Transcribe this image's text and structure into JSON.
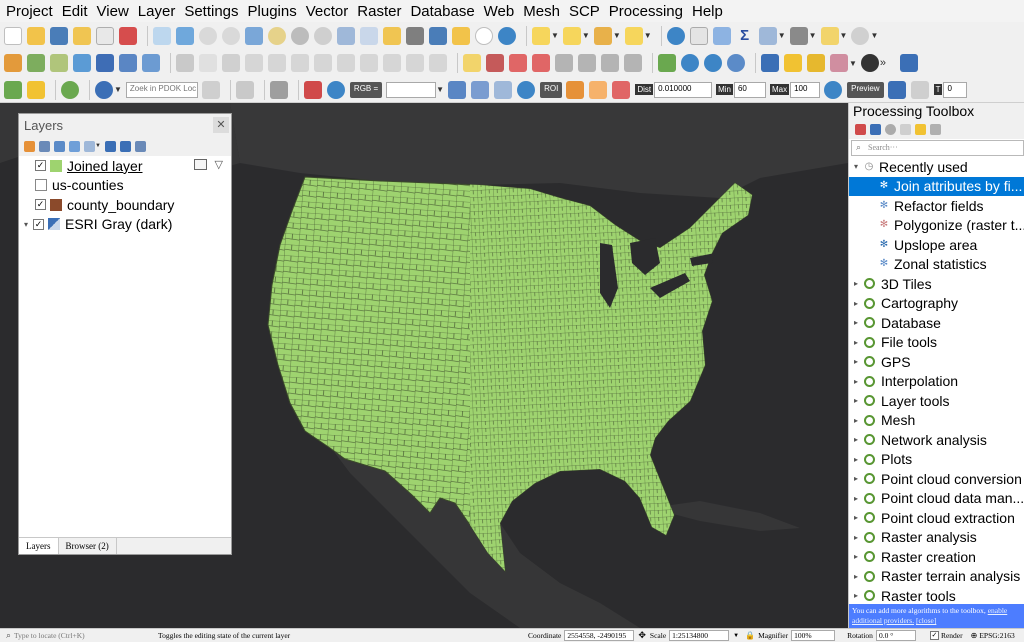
{
  "menubar": [
    "Project",
    "Edit",
    "View",
    "Layer",
    "Settings",
    "Plugins",
    "Vector",
    "Raster",
    "Database",
    "Web",
    "Mesh",
    "SCP",
    "Processing",
    "Help"
  ],
  "toolbar3": {
    "search_placeholder": "Zoek in PDOK Loc···",
    "rgb_label": "RGB =",
    "roi_label": "ROI",
    "dist_label": "Dist",
    "dist_value": "0.010000",
    "min_label": "Min",
    "min_value": "60",
    "max_label": "Max",
    "max_value": "100",
    "preview_label": "Preview",
    "t_label": "T",
    "t_value": "0"
  },
  "layers_panel": {
    "title": "Layers",
    "layers": [
      {
        "name": "Joined layer",
        "checked": true,
        "swatch": "#9ed36f",
        "active": true
      },
      {
        "name": "us-counties",
        "checked": false,
        "table": true
      },
      {
        "name": "county_boundary",
        "checked": true,
        "swatch": "#8b4a2b"
      },
      {
        "name": "ESRI Gray (dark)",
        "checked": true,
        "tiles": true
      }
    ],
    "tabs": [
      "Layers",
      "Browser (2)"
    ]
  },
  "toolbox": {
    "title": "Processing Toolbox",
    "search_placeholder": "Search···",
    "recent_label": "Recently used",
    "recent": [
      "Join attributes by fi...",
      "Refactor fields",
      "Polygonize (raster t...",
      "Upslope area",
      "Zonal statistics"
    ],
    "groups": [
      "3D Tiles",
      "Cartography",
      "Database",
      "File tools",
      "GPS",
      "Interpolation",
      "Layer tools",
      "Mesh",
      "Network analysis",
      "Plots",
      "Point cloud conversion",
      "Point cloud data man...",
      "Point cloud extraction",
      "Raster analysis",
      "Raster creation",
      "Raster terrain analysis",
      "Raster tools"
    ],
    "notice_text": "You can add more algorithms to the toolbox,",
    "notice_link": "enable additional providers.",
    "notice_close": "[close]"
  },
  "statusbar": {
    "locate_placeholder": "Type to locate (Ctrl+K)",
    "message": "Toggles the editing state of the current layer",
    "coordinate_label": "Coordinate",
    "coordinate_value": "2554558, -2490195",
    "scale_label": "Scale",
    "scale_value": "1:25134800",
    "magnifier_label": "Magnifier",
    "magnifier_value": "100%",
    "rotation_label": "Rotation",
    "rotation_value": "0.0 °",
    "render_label": "Render",
    "crs_label": "EPSG:2163"
  },
  "colors": {
    "map_background": "#2b2b2d",
    "county_fill": "#9ed36f",
    "county_stroke": "#3b4a2a",
    "selection": "#0078d7",
    "notice_bg": "#4d7dff"
  }
}
